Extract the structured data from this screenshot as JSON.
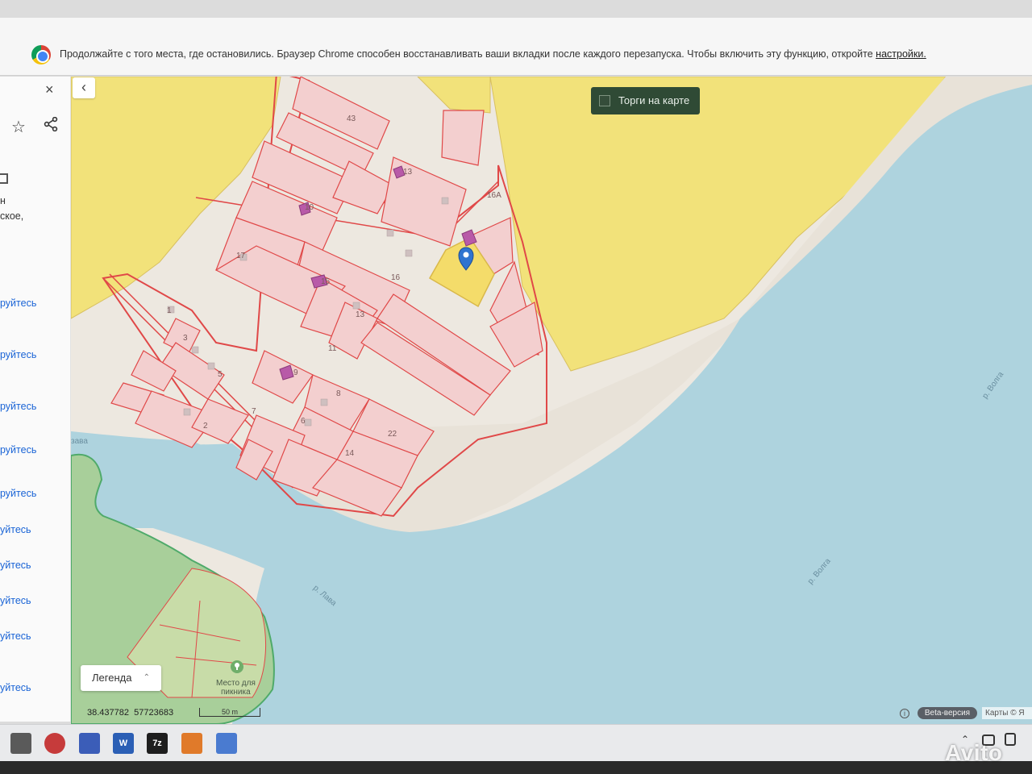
{
  "infobar": {
    "message": "Продолжайте с того места, где остановились. Браузер Chrome способен восстанавливать ваши вкладки после каждого перезапуска. Чтобы включить эту функцию, откройте",
    "link": "настройки."
  },
  "side_panel": {
    "close_glyph": "×",
    "fragments": [
      "н",
      "ское,"
    ],
    "link_fragments": [
      "руйтесь",
      "руйтесь",
      "руйтесь",
      "руйтесь",
      "руйтесь",
      "уйтесь",
      "уйтесь",
      "уйтесь",
      "уйтесь",
      "уйтесь"
    ]
  },
  "map": {
    "torgi_label": "Торги на карте",
    "legend_label": "Легенда",
    "coordinates": {
      "lon": "38.437782",
      "lat": "57723683"
    },
    "scale_label": "50 m",
    "beta_label": "Beta-версия",
    "attribution": "Карты © Я",
    "plot_numbers": [
      "43",
      "13",
      "16А",
      "10",
      "17",
      "15",
      "16",
      "1",
      "3",
      "13",
      "11",
      "5",
      "9",
      "8",
      "6",
      "2",
      "7",
      "22",
      "14"
    ],
    "river_labels": [
      "р. Волга",
      "р. Волга",
      "р. Лава",
      "зава"
    ],
    "poi_label": [
      "Место для",
      "пикника"
    ],
    "colors": {
      "water": "#aed3de",
      "farmland": "#f2e27a",
      "parcel_fill": "#f3cfcf",
      "parcel_border": "#e04848",
      "forest": "#a8cf9a",
      "building": "#b85aa8",
      "selected_parcel": "#f4dc6a",
      "marker": "#2f74d0"
    }
  },
  "taskbar": {
    "apps": [
      "raccoon-app",
      "antivirus-app",
      "media-app",
      "word-app",
      "7zip-app",
      "office-app",
      "notepad-app"
    ],
    "app_glyphs": [
      "",
      "",
      "",
      "W",
      "7z",
      "",
      ""
    ]
  },
  "watermark": "Avito"
}
